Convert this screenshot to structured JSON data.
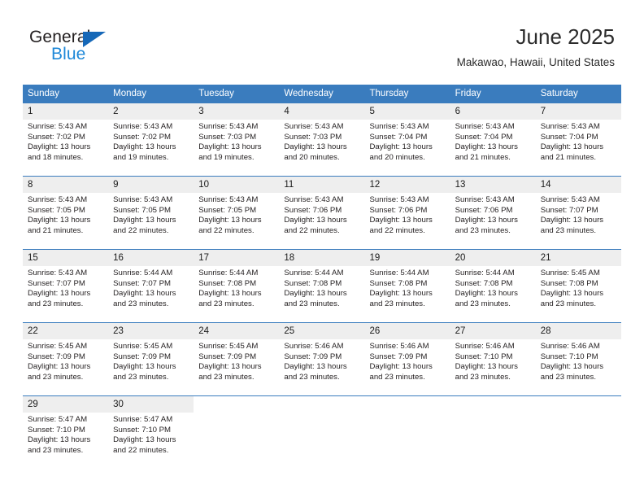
{
  "brand": {
    "name_top": "General",
    "name_bottom": "Blue",
    "accent_color": "#1668b8"
  },
  "header": {
    "title": "June 2025",
    "location": "Makawao, Hawaii, United States"
  },
  "theme": {
    "header_row_bg": "#3a7cbe",
    "daynum_bg": "#eeeeee",
    "text": "#231f20"
  },
  "calendar": {
    "weekday_headers": [
      "Sunday",
      "Monday",
      "Tuesday",
      "Wednesday",
      "Thursday",
      "Friday",
      "Saturday"
    ],
    "weeks": [
      [
        {
          "day": "1",
          "sunrise": "Sunrise: 5:43 AM",
          "sunset": "Sunset: 7:02 PM",
          "daylight1": "Daylight: 13 hours",
          "daylight2": "and 18 minutes."
        },
        {
          "day": "2",
          "sunrise": "Sunrise: 5:43 AM",
          "sunset": "Sunset: 7:02 PM",
          "daylight1": "Daylight: 13 hours",
          "daylight2": "and 19 minutes."
        },
        {
          "day": "3",
          "sunrise": "Sunrise: 5:43 AM",
          "sunset": "Sunset: 7:03 PM",
          "daylight1": "Daylight: 13 hours",
          "daylight2": "and 19 minutes."
        },
        {
          "day": "4",
          "sunrise": "Sunrise: 5:43 AM",
          "sunset": "Sunset: 7:03 PM",
          "daylight1": "Daylight: 13 hours",
          "daylight2": "and 20 minutes."
        },
        {
          "day": "5",
          "sunrise": "Sunrise: 5:43 AM",
          "sunset": "Sunset: 7:04 PM",
          "daylight1": "Daylight: 13 hours",
          "daylight2": "and 20 minutes."
        },
        {
          "day": "6",
          "sunrise": "Sunrise: 5:43 AM",
          "sunset": "Sunset: 7:04 PM",
          "daylight1": "Daylight: 13 hours",
          "daylight2": "and 21 minutes."
        },
        {
          "day": "7",
          "sunrise": "Sunrise: 5:43 AM",
          "sunset": "Sunset: 7:04 PM",
          "daylight1": "Daylight: 13 hours",
          "daylight2": "and 21 minutes."
        }
      ],
      [
        {
          "day": "8",
          "sunrise": "Sunrise: 5:43 AM",
          "sunset": "Sunset: 7:05 PM",
          "daylight1": "Daylight: 13 hours",
          "daylight2": "and 21 minutes."
        },
        {
          "day": "9",
          "sunrise": "Sunrise: 5:43 AM",
          "sunset": "Sunset: 7:05 PM",
          "daylight1": "Daylight: 13 hours",
          "daylight2": "and 22 minutes."
        },
        {
          "day": "10",
          "sunrise": "Sunrise: 5:43 AM",
          "sunset": "Sunset: 7:05 PM",
          "daylight1": "Daylight: 13 hours",
          "daylight2": "and 22 minutes."
        },
        {
          "day": "11",
          "sunrise": "Sunrise: 5:43 AM",
          "sunset": "Sunset: 7:06 PM",
          "daylight1": "Daylight: 13 hours",
          "daylight2": "and 22 minutes."
        },
        {
          "day": "12",
          "sunrise": "Sunrise: 5:43 AM",
          "sunset": "Sunset: 7:06 PM",
          "daylight1": "Daylight: 13 hours",
          "daylight2": "and 22 minutes."
        },
        {
          "day": "13",
          "sunrise": "Sunrise: 5:43 AM",
          "sunset": "Sunset: 7:06 PM",
          "daylight1": "Daylight: 13 hours",
          "daylight2": "and 23 minutes."
        },
        {
          "day": "14",
          "sunrise": "Sunrise: 5:43 AM",
          "sunset": "Sunset: 7:07 PM",
          "daylight1": "Daylight: 13 hours",
          "daylight2": "and 23 minutes."
        }
      ],
      [
        {
          "day": "15",
          "sunrise": "Sunrise: 5:43 AM",
          "sunset": "Sunset: 7:07 PM",
          "daylight1": "Daylight: 13 hours",
          "daylight2": "and 23 minutes."
        },
        {
          "day": "16",
          "sunrise": "Sunrise: 5:44 AM",
          "sunset": "Sunset: 7:07 PM",
          "daylight1": "Daylight: 13 hours",
          "daylight2": "and 23 minutes."
        },
        {
          "day": "17",
          "sunrise": "Sunrise: 5:44 AM",
          "sunset": "Sunset: 7:08 PM",
          "daylight1": "Daylight: 13 hours",
          "daylight2": "and 23 minutes."
        },
        {
          "day": "18",
          "sunrise": "Sunrise: 5:44 AM",
          "sunset": "Sunset: 7:08 PM",
          "daylight1": "Daylight: 13 hours",
          "daylight2": "and 23 minutes."
        },
        {
          "day": "19",
          "sunrise": "Sunrise: 5:44 AM",
          "sunset": "Sunset: 7:08 PM",
          "daylight1": "Daylight: 13 hours",
          "daylight2": "and 23 minutes."
        },
        {
          "day": "20",
          "sunrise": "Sunrise: 5:44 AM",
          "sunset": "Sunset: 7:08 PM",
          "daylight1": "Daylight: 13 hours",
          "daylight2": "and 23 minutes."
        },
        {
          "day": "21",
          "sunrise": "Sunrise: 5:45 AM",
          "sunset": "Sunset: 7:08 PM",
          "daylight1": "Daylight: 13 hours",
          "daylight2": "and 23 minutes."
        }
      ],
      [
        {
          "day": "22",
          "sunrise": "Sunrise: 5:45 AM",
          "sunset": "Sunset: 7:09 PM",
          "daylight1": "Daylight: 13 hours",
          "daylight2": "and 23 minutes."
        },
        {
          "day": "23",
          "sunrise": "Sunrise: 5:45 AM",
          "sunset": "Sunset: 7:09 PM",
          "daylight1": "Daylight: 13 hours",
          "daylight2": "and 23 minutes."
        },
        {
          "day": "24",
          "sunrise": "Sunrise: 5:45 AM",
          "sunset": "Sunset: 7:09 PM",
          "daylight1": "Daylight: 13 hours",
          "daylight2": "and 23 minutes."
        },
        {
          "day": "25",
          "sunrise": "Sunrise: 5:46 AM",
          "sunset": "Sunset: 7:09 PM",
          "daylight1": "Daylight: 13 hours",
          "daylight2": "and 23 minutes."
        },
        {
          "day": "26",
          "sunrise": "Sunrise: 5:46 AM",
          "sunset": "Sunset: 7:09 PM",
          "daylight1": "Daylight: 13 hours",
          "daylight2": "and 23 minutes."
        },
        {
          "day": "27",
          "sunrise": "Sunrise: 5:46 AM",
          "sunset": "Sunset: 7:10 PM",
          "daylight1": "Daylight: 13 hours",
          "daylight2": "and 23 minutes."
        },
        {
          "day": "28",
          "sunrise": "Sunrise: 5:46 AM",
          "sunset": "Sunset: 7:10 PM",
          "daylight1": "Daylight: 13 hours",
          "daylight2": "and 23 minutes."
        }
      ],
      [
        {
          "day": "29",
          "sunrise": "Sunrise: 5:47 AM",
          "sunset": "Sunset: 7:10 PM",
          "daylight1": "Daylight: 13 hours",
          "daylight2": "and 23 minutes."
        },
        {
          "day": "30",
          "sunrise": "Sunrise: 5:47 AM",
          "sunset": "Sunset: 7:10 PM",
          "daylight1": "Daylight: 13 hours",
          "daylight2": "and 22 minutes."
        },
        {
          "day": "",
          "sunrise": "",
          "sunset": "",
          "daylight1": "",
          "daylight2": ""
        },
        {
          "day": "",
          "sunrise": "",
          "sunset": "",
          "daylight1": "",
          "daylight2": ""
        },
        {
          "day": "",
          "sunrise": "",
          "sunset": "",
          "daylight1": "",
          "daylight2": ""
        },
        {
          "day": "",
          "sunrise": "",
          "sunset": "",
          "daylight1": "",
          "daylight2": ""
        },
        {
          "day": "",
          "sunrise": "",
          "sunset": "",
          "daylight1": "",
          "daylight2": ""
        }
      ]
    ]
  }
}
